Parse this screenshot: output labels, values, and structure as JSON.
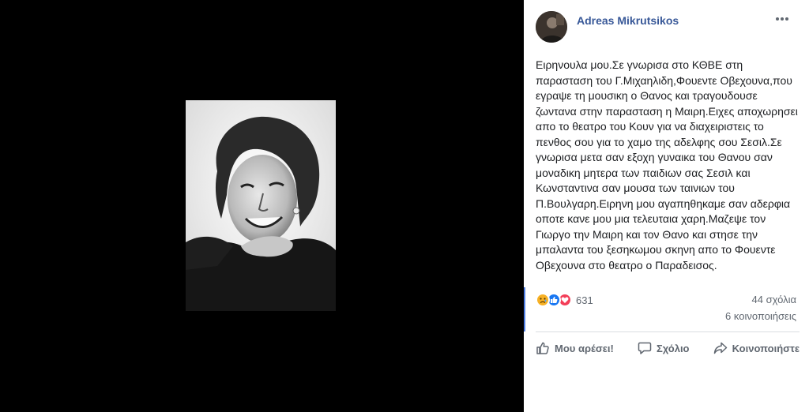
{
  "post": {
    "author": "Adreas Mikrutsikos",
    "text": "Ειρηνουλα μου.Σε γνωρισα στο ΚΘΒΕ στη παρασταση του Γ.Μιχαηλιδη,Φουεντε Οβεχουνα,που εγραψε τη μουσικη ο Θανος και τραγουδουσε ζωντανα στην παρασταση η Μαιρη.Ειχες αποχωρησει απο το θεατρο του Κουν για να διαχειριστεις το πενθος σου για το χαμο της αδελφης σου Σεσιλ.Σε γνωρισα μετα σαν εξοχη γυναικα του Θανου σαν μοναδικη μητερα των παιδιων σας Σεσιλ και Κωνσταντινα σαν μουσα των ταινιων του Π.Βουλγαρη.Ειρηνη μου αγαπηθηκαμε σαν αδερφια οποτε κανε μου μια τελευταια χαρη.Μαζεψε τον Γιωργο την Μαιρη και τον Θανο και στησε την μπαλαντα του ξεσηκωμου σκηνη απο το Φουεντε Οβεχουνα στο θεατρο ο Παραδεισος."
  },
  "stats": {
    "reaction_count": "631",
    "comments": "44 σχόλια",
    "shares": "6 κοινοποιήσεις",
    "reaction_icons": [
      "sad-reaction",
      "like-reaction",
      "love-reaction"
    ]
  },
  "actions": {
    "like": "Μου αρέσει!",
    "comment": "Σχόλιο",
    "share": "Κοινοποιήστε"
  },
  "colors": {
    "author_link": "#385898",
    "secondary_text": "#606770",
    "photo_background": "#000000"
  }
}
